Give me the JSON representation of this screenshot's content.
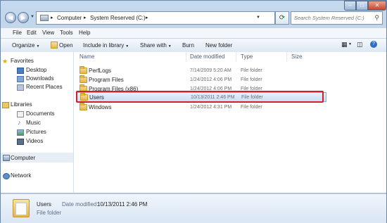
{
  "window": {
    "breadcrumb": [
      "Computer",
      "System Reserved (C:)"
    ],
    "search_placeholder": "Search System Reserved (C:)",
    "controls": {
      "minimize": "–",
      "maximize": "□",
      "close": "✕"
    }
  },
  "menu": [
    "File",
    "Edit",
    "View",
    "Tools",
    "Help"
  ],
  "toolbar": {
    "organize": "Organize",
    "open": "Open",
    "include_in_library": "Include in library",
    "share_with": "Share with",
    "burn": "Burn",
    "new_folder": "New folder"
  },
  "sidebar": {
    "favorites": {
      "label": "Favorites",
      "items": [
        "Desktop",
        "Downloads",
        "Recent Places"
      ]
    },
    "libraries": {
      "label": "Libraries",
      "items": [
        "Documents",
        "Music",
        "Pictures",
        "Videos"
      ]
    },
    "computer": "Computer",
    "network": "Network"
  },
  "columns": [
    "Name",
    "Date modified",
    "Type",
    "Size"
  ],
  "files": [
    {
      "name": "PerfLogs",
      "date": "7/14/2009 5:20 AM",
      "type": "File folder",
      "size": ""
    },
    {
      "name": "Program Files",
      "date": "1/24/2012 4:06 PM",
      "type": "File folder",
      "size": ""
    },
    {
      "name": "Program Files (x86)",
      "date": "1/24/2012 4:06 PM",
      "type": "File folder",
      "size": ""
    },
    {
      "name": "Users",
      "date": "10/13/2011 2:46 PM",
      "type": "File folder",
      "size": ""
    },
    {
      "name": "Windows",
      "date": "1/24/2012 4:31 PM",
      "type": "File folder",
      "size": ""
    }
  ],
  "details": {
    "name": "Users",
    "date_label": "Date modified:",
    "date_value": "10/13/2011 2:46 PM",
    "type": "File folder"
  },
  "colors": {
    "selection_border": "#84acdd",
    "annotation_box": "#d0202a",
    "folder": "#e2b546"
  }
}
